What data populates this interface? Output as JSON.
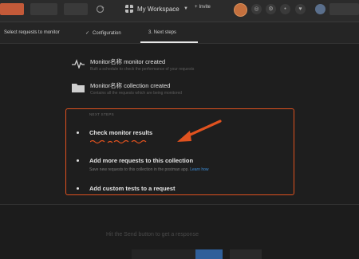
{
  "topbar": {
    "new_label": "",
    "import_label": "",
    "runner_label": "",
    "workspace": "My Workspace",
    "invite": "Invite"
  },
  "steps": {
    "step1": "Select requests to monitor",
    "step2": "Configuration",
    "step3": "3. Next steps"
  },
  "created": [
    {
      "title": "Monitor名称 monitor created",
      "desc": "Built a schedule to check the performance of your requests"
    },
    {
      "title": "Monitor名称 collection created",
      "desc": "Contains all the requests which are being monitored"
    }
  ],
  "next_steps": {
    "label": "NEXT STEPS",
    "items": [
      {
        "title": "Check monitor results",
        "desc": ""
      },
      {
        "title": "Add more requests to this collection",
        "desc": "Save new requests to this collection in the postman app.",
        "link": "Learn how"
      },
      {
        "title": "Add custom tests to a request",
        "desc": ""
      }
    ]
  },
  "bottom": {
    "text": "Hit the Send button to get a response"
  },
  "colors": {
    "accent": "#e0521f",
    "link": "#3c8ed9",
    "background": "#1e1e1e"
  },
  "icons": {
    "monitor": "pulse-icon",
    "collection": "folder-icon",
    "arrow": "annotation-arrow"
  }
}
